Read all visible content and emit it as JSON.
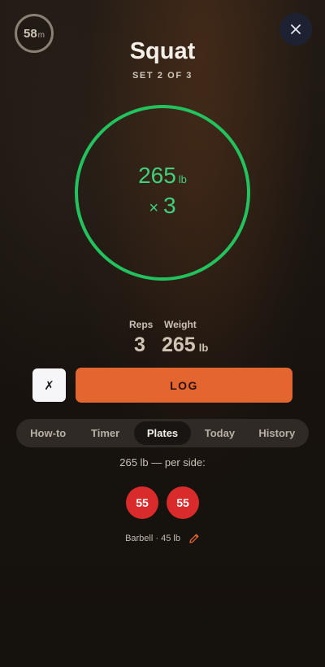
{
  "header": {
    "timer_value": "58",
    "timer_unit": "m",
    "title": "Squat",
    "subtitle": "SET 2 OF 3"
  },
  "ring": {
    "weight": "265",
    "weight_unit": "lb",
    "reps_prefix": "×",
    "reps": "3",
    "color": "#22c35e"
  },
  "stats": {
    "reps_label": "Reps",
    "weight_label": "Weight",
    "reps_value": "3",
    "weight_value": "265",
    "weight_unit": "lb"
  },
  "actions": {
    "cancel_label": "✗",
    "log_label": "LOG",
    "accent": "#e3652f"
  },
  "tabs": [
    {
      "label": "How-to",
      "active": false
    },
    {
      "label": "Timer",
      "active": false
    },
    {
      "label": "Plates",
      "active": true
    },
    {
      "label": "Today",
      "active": false
    },
    {
      "label": "History",
      "active": false
    }
  ],
  "plates": {
    "per_side_text": "265 lb — per side:",
    "list": [
      "55",
      "55"
    ],
    "plate_color": "#d92b2b",
    "barbell_text": "Barbell · 45 lb"
  },
  "icons": {
    "close": "close-icon",
    "edit": "pencil-icon"
  }
}
